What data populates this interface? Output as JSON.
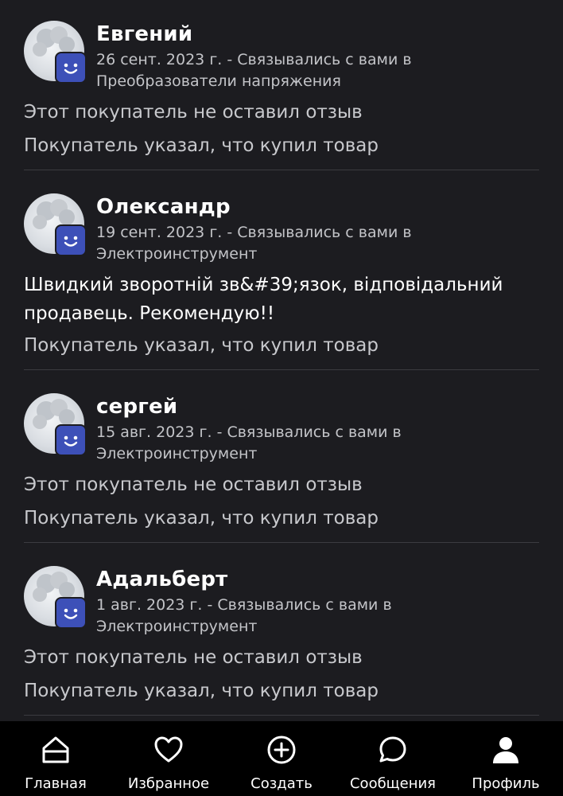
{
  "reviews": [
    {
      "name": "Евгений",
      "meta": "26 сент. 2023 г. - Связывались с вами в Преобразователи напряжения",
      "comment": "Этот покупатель не оставил отзыв",
      "purchase": "Покупатель указал, что купил товар"
    },
    {
      "name": "Олександр",
      "meta": "19 сент. 2023 г. - Связывались с вами в Электроинструмент",
      "comment": "Швидкий зворотній зв&#39;язок, відповідальний продавець. Рекомендую!!",
      "purchase": "Покупатель указал, что купил товар"
    },
    {
      "name": "сергей",
      "meta": "15 авг. 2023 г. - Связывались с вами в Электроинструмент",
      "comment": "Этот покупатель не оставил отзыв",
      "purchase": "Покупатель указал, что купил товар"
    },
    {
      "name": "Адальберт",
      "meta": "1 авг. 2023 г. - Связывались с вами в Электроинструмент",
      "comment": "Этот покупатель не оставил отзыв",
      "purchase": "Покупатель указал, что купил товар"
    }
  ],
  "avatar_icons": {
    "photo": "cloud-avatar-icon",
    "badge": "smiley-face-icon"
  },
  "nav": {
    "items": [
      {
        "label": "Главная",
        "icon": "home-icon"
      },
      {
        "label": "Избранное",
        "icon": "heart-icon"
      },
      {
        "label": "Создать",
        "icon": "plus-circle-icon"
      },
      {
        "label": "Сообщения",
        "icon": "chat-bubble-icon"
      },
      {
        "label": "Профиль",
        "icon": "person-icon"
      }
    ]
  },
  "colors": {
    "background": "#1c1c20",
    "navbar": "#000000",
    "badge": "#3d50b8",
    "muted_text": "#c8c9cd",
    "divider": "#3b3b40"
  }
}
